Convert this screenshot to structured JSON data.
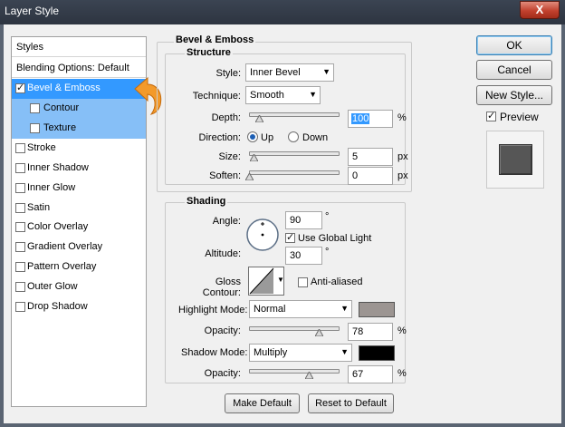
{
  "window": {
    "title": "Layer Style",
    "close_label": "X"
  },
  "left_list": {
    "header": "Styles",
    "blending": "Blending Options: Default",
    "items": [
      {
        "label": "Bevel & Emboss",
        "checked": true
      },
      {
        "label": "Contour",
        "checked": false
      },
      {
        "label": "Texture",
        "checked": false
      },
      {
        "label": "Stroke",
        "checked": false
      },
      {
        "label": "Inner Shadow",
        "checked": false
      },
      {
        "label": "Inner Glow",
        "checked": false
      },
      {
        "label": "Satin",
        "checked": false
      },
      {
        "label": "Color Overlay",
        "checked": false
      },
      {
        "label": "Gradient Overlay",
        "checked": false
      },
      {
        "label": "Pattern Overlay",
        "checked": false
      },
      {
        "label": "Outer Glow",
        "checked": false
      },
      {
        "label": "Drop Shadow",
        "checked": false
      }
    ]
  },
  "bevel": {
    "title": "Bevel & Emboss",
    "structure_title": "Structure",
    "style_label": "Style:",
    "style_value": "Inner Bevel",
    "technique_label": "Technique:",
    "technique_value": "Smooth",
    "depth_label": "Depth:",
    "depth_value": "100",
    "depth_unit": "%",
    "direction_label": "Direction:",
    "direction_up": "Up",
    "direction_down": "Down",
    "size_label": "Size:",
    "size_value": "5",
    "size_unit": "px",
    "soften_label": "Soften:",
    "soften_value": "0",
    "soften_unit": "px"
  },
  "shading": {
    "title": "Shading",
    "angle_label": "Angle:",
    "angle_value": "90",
    "degree": "°",
    "global_light_label": "Use Global Light",
    "global_light_checked": true,
    "altitude_label": "Altitude:",
    "altitude_value": "30",
    "gloss_label": "Gloss Contour:",
    "anti_aliased_label": "Anti-aliased",
    "anti_aliased_checked": false,
    "highlight_label": "Highlight Mode:",
    "highlight_value": "Normal",
    "highlight_color": "#9c9592",
    "highlight_opacity_label": "Opacity:",
    "highlight_opacity": "78",
    "pct": "%",
    "shadow_label": "Shadow Mode:",
    "shadow_value": "Multiply",
    "shadow_color": "#000000",
    "shadow_opacity_label": "Opacity:",
    "shadow_opacity": "67"
  },
  "footer": {
    "make_default": "Make Default",
    "reset_default": "Reset to Default"
  },
  "right": {
    "ok": "OK",
    "cancel": "Cancel",
    "new_style": "New Style...",
    "preview_label": "Preview",
    "preview_checked": true
  },
  "colors": {
    "selection": "#3399ff",
    "sub_selection": "#86bff7",
    "arrow": "#f39a2b"
  }
}
